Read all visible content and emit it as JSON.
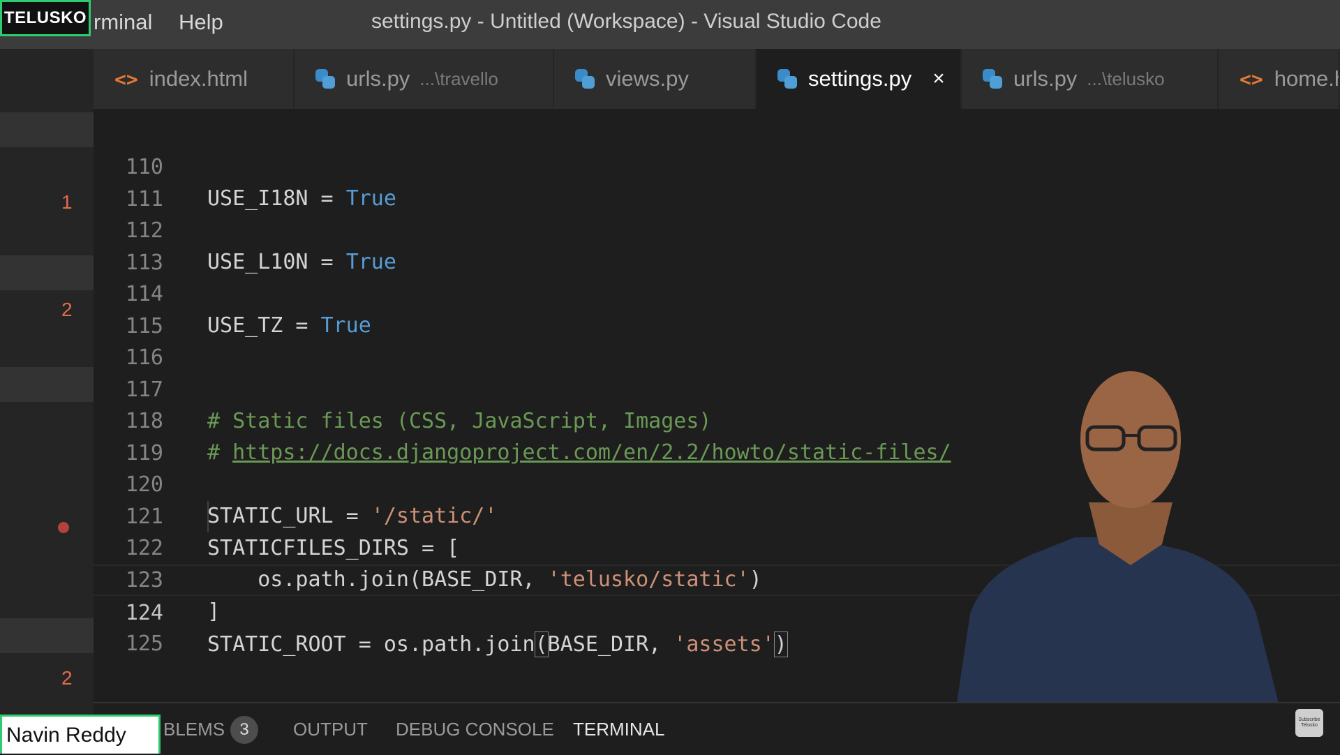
{
  "branding": {
    "logo": "TELUSKO"
  },
  "menu": {
    "terminal": "rminal",
    "help": "Help"
  },
  "window_title": "settings.py - Untitled (Workspace) - Visual Studio Code",
  "tabs": [
    {
      "label": "index.html",
      "path": "",
      "icon": "html-icon"
    },
    {
      "label": "urls.py",
      "path": "...\\travello",
      "icon": "python-icon"
    },
    {
      "label": "views.py",
      "path": "",
      "icon": "python-icon"
    },
    {
      "label": "settings.py",
      "path": "",
      "icon": "python-icon",
      "active": true,
      "close": "×"
    },
    {
      "label": "urls.py",
      "path": "...\\telusko",
      "icon": "python-icon"
    },
    {
      "label": "home.h",
      "path": "",
      "icon": "html-icon"
    }
  ],
  "glyph_margin": {
    "marks": [
      "1",
      "2",
      "2"
    ]
  },
  "editor": {
    "lines": [
      {
        "n": "110",
        "a": "USE_I18N = ",
        "b": "True"
      },
      {
        "n": "111"
      },
      {
        "n": "112",
        "a": "USE_L10N = ",
        "b": "True"
      },
      {
        "n": "113"
      },
      {
        "n": "114",
        "a": "USE_TZ = ",
        "b": "True"
      },
      {
        "n": "115"
      },
      {
        "n": "116"
      },
      {
        "n": "117",
        "comment": "# Static files (CSS, JavaScript, Images)"
      },
      {
        "n": "118",
        "hash": "# ",
        "url": "https://docs.djangoproject.com/en/2.2/howto/static-files/"
      },
      {
        "n": "119"
      },
      {
        "n": "120",
        "a": "STATIC_URL = ",
        "s": "'/static/'"
      },
      {
        "n": "121",
        "a": "STATICFILES_DIRS = ["
      },
      {
        "n": "122",
        "a": "    os.path.join(BASE_DIR, ",
        "s": "'telusko/static'",
        "c": ")"
      },
      {
        "n": "123",
        "a": "]"
      },
      {
        "n": "124",
        "a": "STATIC_ROOT = os.path.join",
        "p1": "(",
        "m": "BASE_DIR, ",
        "s": "'assets'",
        "p2": ")"
      },
      {
        "n": "125"
      }
    ]
  },
  "panel": {
    "tabs": [
      "BLEMS",
      "OUTPUT",
      "DEBUG CONSOLE",
      "TERMINAL"
    ],
    "problems_count": "3"
  },
  "presenter": {
    "name": "Navin Reddy"
  },
  "subscribe": {
    "line1": "Subscribe",
    "line2": "Telusko"
  },
  "colors": {
    "keyword": "#569cd6",
    "string": "#ce9178",
    "comment": "#6a9955",
    "accent": "#2ecc71"
  }
}
